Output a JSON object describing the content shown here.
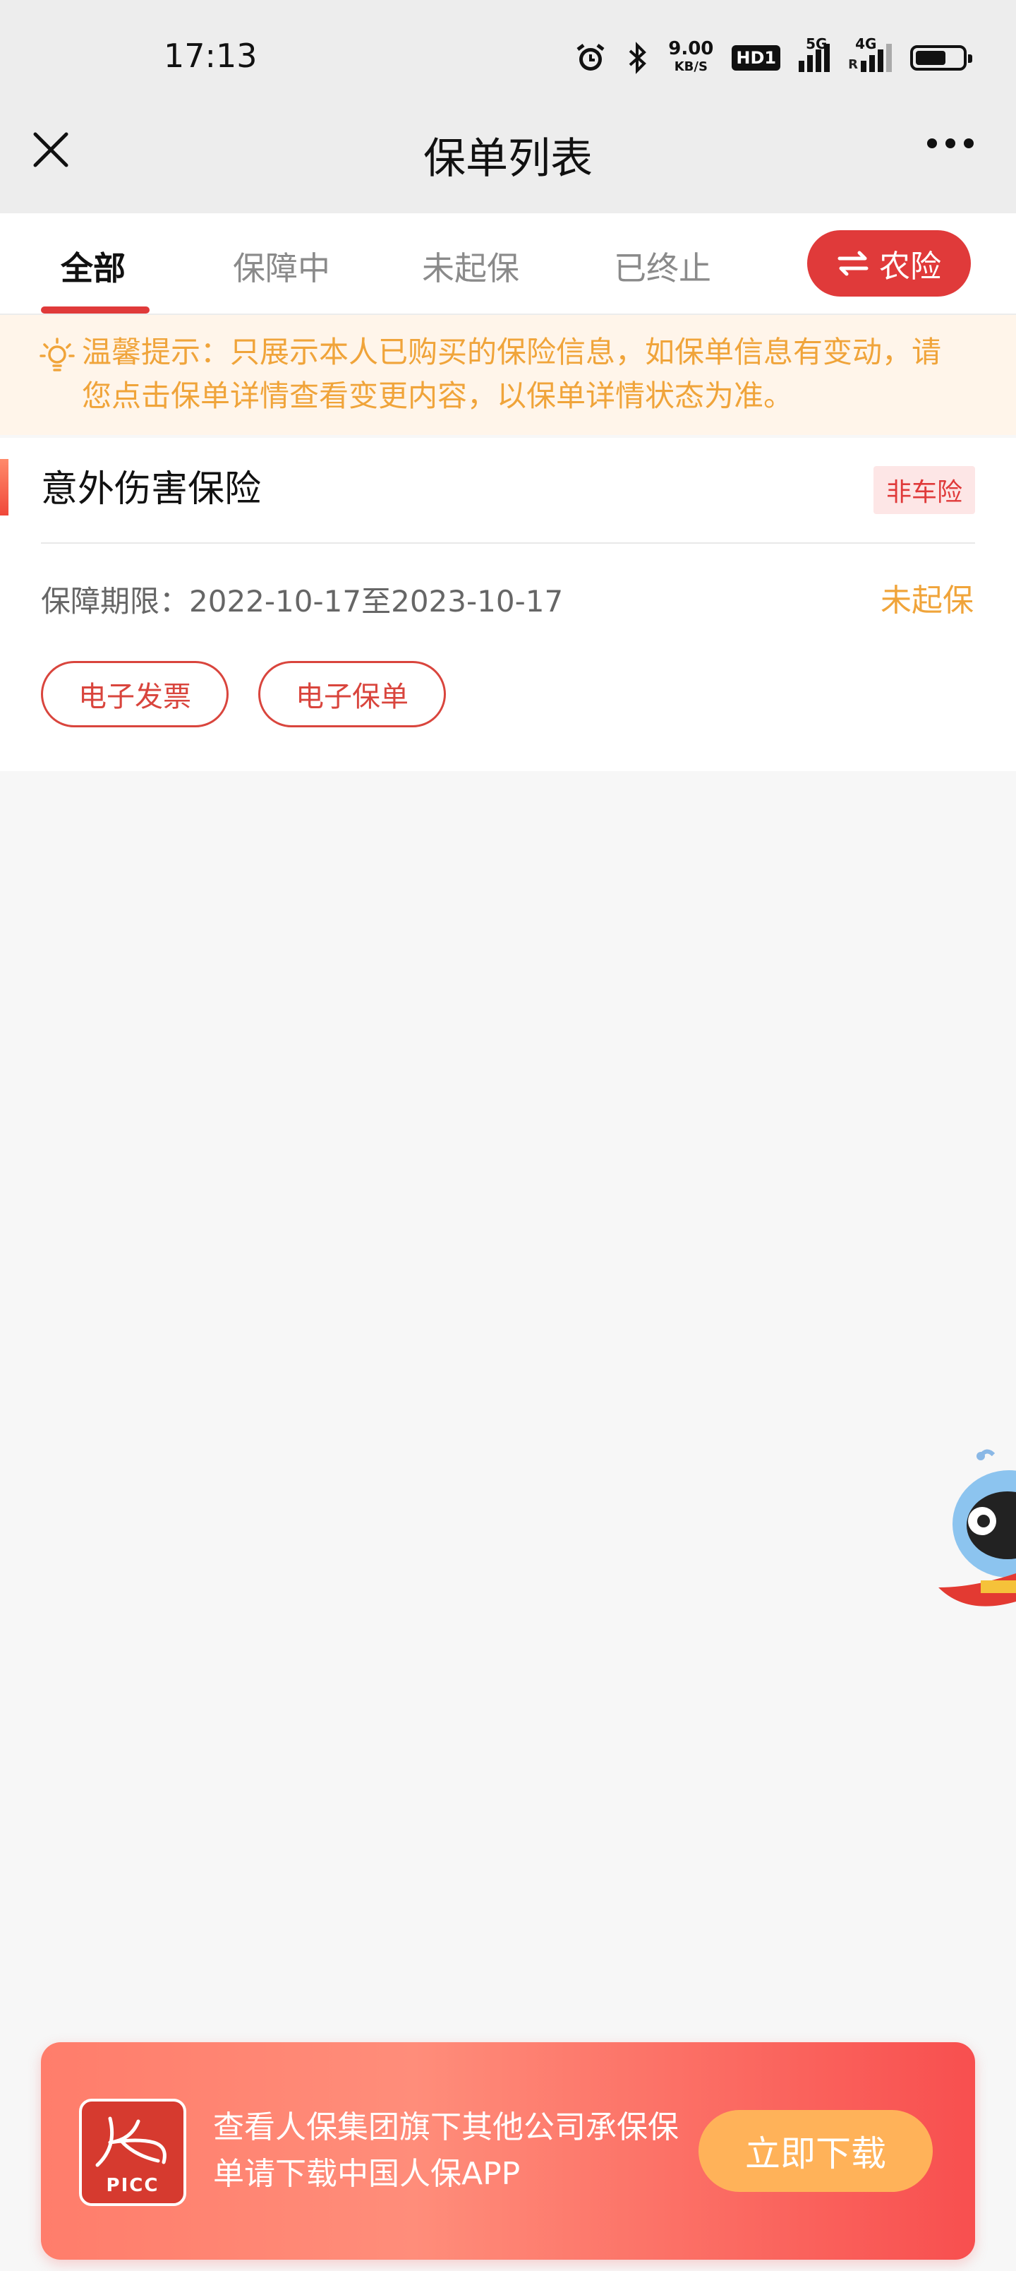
{
  "status_bar": {
    "time": "17:13",
    "net_speed_value": "9.00",
    "net_speed_unit": "KB/S",
    "hd_label": "HD1",
    "sig1_label": "5G",
    "sig2_label": "4G",
    "sig2_sub": "R",
    "battery_level": 0.65
  },
  "nav": {
    "title": "保单列表"
  },
  "tabs": {
    "items": [
      {
        "label": "全部"
      },
      {
        "label": "保障中"
      },
      {
        "label": "未起保"
      },
      {
        "label": "已终止"
      }
    ],
    "active_index": 0,
    "switch_button_label": "农险",
    "switch_icon": "swap-arrows-icon"
  },
  "notice": {
    "text": "温馨提示：只展示本人已购买的保险信息，如保单信息有变动，请您点击保单详情查看变更内容，以保单详情状态为准。",
    "icon": "lightbulb-icon"
  },
  "policy": {
    "title": "意外伤害保险",
    "badge": "非车险",
    "period_label": "保障期限：",
    "period_value": "2022-10-17至2023-10-17",
    "status": "未起保",
    "buttons": [
      "电子发票",
      "电子保单"
    ]
  },
  "banner": {
    "logo_text": "PICC",
    "text": "查看人保集团旗下其他公司承保保单请下载中国人保APP",
    "button_label": "立即下载"
  },
  "colors": {
    "accent_red": "#e03a3a",
    "warning_orange": "#f0a43a",
    "banner_button": "#ffb259"
  }
}
